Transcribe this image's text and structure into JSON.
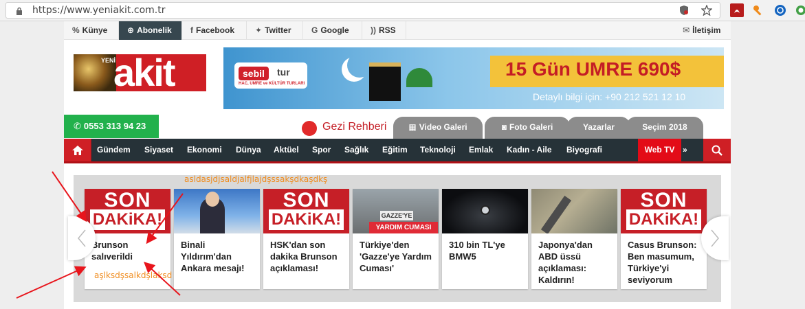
{
  "browser": {
    "url": "https://www.yeniakit.com.tr"
  },
  "topbar": {
    "links": [
      {
        "label": "Künye"
      },
      {
        "label": "Abonelik"
      },
      {
        "label": "Facebook"
      },
      {
        "label": "Twitter"
      },
      {
        "label": "Google"
      },
      {
        "label": "RSS"
      }
    ],
    "contact": "İletişim"
  },
  "logo": {
    "small": "YENİ",
    "main": "akit"
  },
  "banner": {
    "brand_a": "sebil",
    "brand_b": "tur",
    "brand_sub": "HAC, UMRE ve KÜLTÜR TURLARI",
    "headline": "15 Gün UMRE 690$",
    "info": "Detaylı bilgi için: +90 212 521 12 10"
  },
  "phone": "0553 313 94 23",
  "gezi": "Gezi Rehberi",
  "tabs": [
    {
      "label": "Video Galeri"
    },
    {
      "label": "Foto Galeri"
    },
    {
      "label": "Yazarlar"
    },
    {
      "label": "Seçim 2018"
    }
  ],
  "nav": {
    "items": [
      "Gündem",
      "Siyaset",
      "Ekonomi",
      "Dünya",
      "Aktüel",
      "Spor",
      "Sağlık",
      "Eğitim",
      "Teknoloji",
      "Emlak",
      "Kadın - Aile",
      "Biyografi"
    ],
    "webtv": "Web TV",
    "more": "Tümü"
  },
  "sondakika": {
    "top": "SON",
    "bottom": "DAKiKA!"
  },
  "thumb_texts": {
    "gazze": "GAZZE'YE",
    "yardim": "YARDIM CUMASI"
  },
  "cards": [
    {
      "caption": "Brunson salıverildi"
    },
    {
      "caption": "Binali Yıldırım'dan Ankara mesajı!"
    },
    {
      "caption": "HSK'dan son dakika Brunson açıklaması!"
    },
    {
      "caption": "Türkiye'den 'Gazze'ye Yardım Cuması'"
    },
    {
      "caption": "310 bin TL'ye BMW5"
    },
    {
      "caption": "Japonya'dan ABD üssü açıklaması: Kaldırın!"
    },
    {
      "caption": "Casus Brunson: Ben masumum, Türkiye'yi seviyorum"
    }
  ],
  "annotations": {
    "top": "asldasjdjsaldjalfjlajdşssakşdkaşdkş",
    "bottom": "aşlksdşsalkdşlaksd"
  },
  "colors": {
    "brand_red": "#cf1f25",
    "nav_dark": "#263238",
    "webtv_red": "#e30b17",
    "phone_green": "#22b14c",
    "annotation_orange": "#f08c1e"
  }
}
